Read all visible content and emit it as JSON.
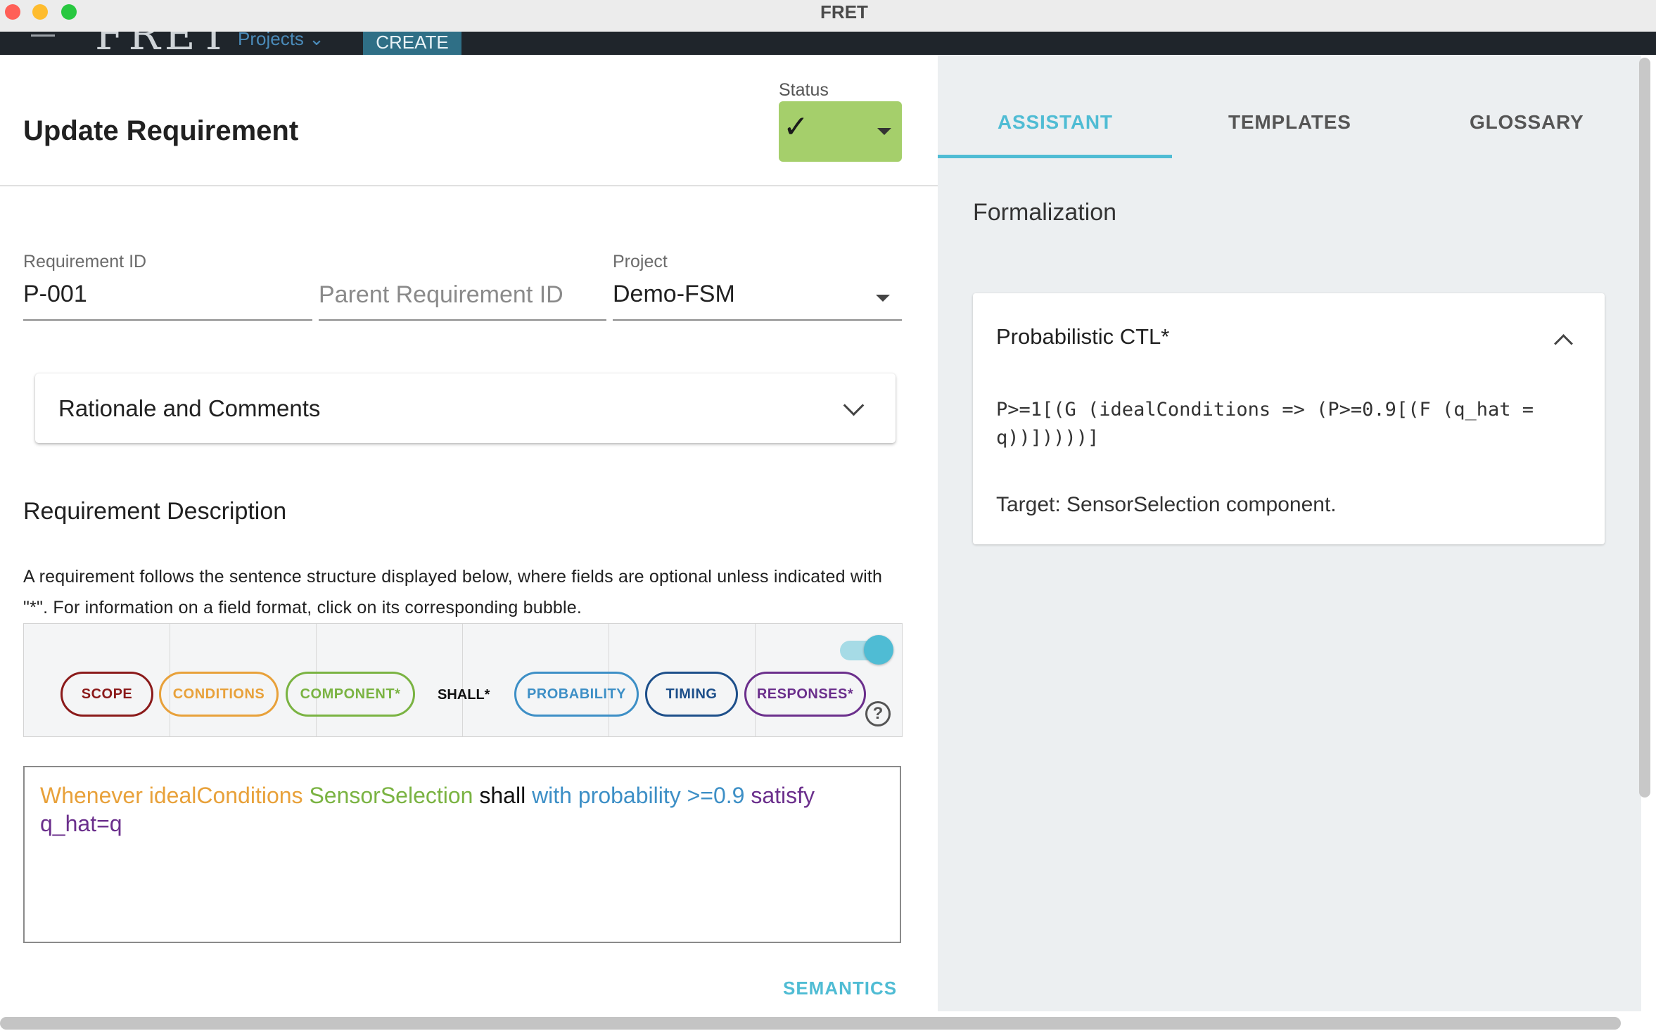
{
  "window": {
    "title": "FRET"
  },
  "appbar": {
    "projects_label": "Projects",
    "create_label": "CREATE"
  },
  "header": {
    "title": "Update Requirement",
    "status_label": "Status",
    "status_icon": "check-icon",
    "status_color": "#a5cf6b"
  },
  "fields": {
    "requirement_id": {
      "label": "Requirement ID",
      "value": "P-001"
    },
    "parent_requirement_id": {
      "placeholder": "Parent Requirement ID"
    },
    "project": {
      "label": "Project",
      "value": "Demo-FSM"
    }
  },
  "rationale": {
    "title": "Rationale and Comments"
  },
  "description": {
    "title": "Requirement Description",
    "help_text": "A requirement follows the sentence structure displayed below, where fields are optional unless indicated with \"*\". For information on a field format, click on its corresponding bubble."
  },
  "bubbles": [
    {
      "label": "SCOPE",
      "color": "#8b1a1a"
    },
    {
      "label": "CONDITIONS",
      "color": "#e8a13a"
    },
    {
      "label": "COMPONENT*",
      "color": "#7ab342"
    },
    {
      "label": "SHALL*",
      "color": "#111111"
    },
    {
      "label": "PROBABILITY",
      "color": "#3d8fc6"
    },
    {
      "label": "TIMING",
      "color": "#1d4f8a"
    },
    {
      "label": "RESPONSES*",
      "color": "#6b2f8c"
    }
  ],
  "editor": {
    "segments": [
      {
        "text": "Whenever idealConditions ",
        "color": "#e8a13a"
      },
      {
        "text": "SensorSelection ",
        "color": "#7ab342"
      },
      {
        "text": "shall ",
        "color": "#111111"
      },
      {
        "text": "with probability >=0.9 ",
        "color": "#3d8fc6"
      },
      {
        "text": "satisfy q_hat=q",
        "color": "#6b2f8c"
      }
    ]
  },
  "semantics_label": "SEMANTICS",
  "tabs": [
    {
      "label": "ASSISTANT",
      "active": true
    },
    {
      "label": "TEMPLATES",
      "active": false
    },
    {
      "label": "GLOSSARY",
      "active": false
    }
  ],
  "formalization": {
    "title": "Formalization",
    "card_title": "Probabilistic CTL*",
    "formula_line1": "P>=1[(G (idealConditions => (P>=0.9[(F (q_hat =",
    "formula_line2": "q))]))))]",
    "target": "Target: SensorSelection component."
  },
  "accent_color": "#4fbcd4"
}
